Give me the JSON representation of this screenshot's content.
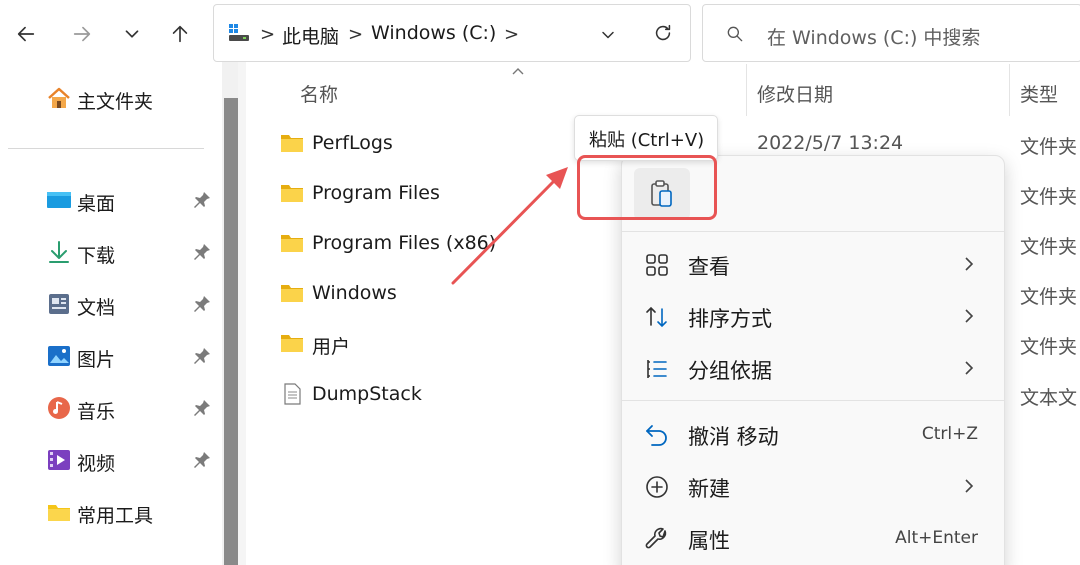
{
  "nav": {
    "back_icon": "arrow-left-icon",
    "forward_icon": "arrow-right-icon",
    "recent_icon": "chevron-down-icon",
    "up_icon": "arrow-up-icon"
  },
  "address": {
    "crumbs": [
      "此电脑",
      "Windows (C:)"
    ],
    "separator": ">"
  },
  "search": {
    "placeholder": "在 Windows (C:) 中搜索"
  },
  "sidebar": {
    "home": "主文件夹",
    "items": [
      {
        "label": "桌面",
        "icon": "desktop-icon",
        "pinned": true
      },
      {
        "label": "下载",
        "icon": "download-icon",
        "pinned": true
      },
      {
        "label": "文档",
        "icon": "document-icon",
        "pinned": true
      },
      {
        "label": "图片",
        "icon": "picture-icon",
        "pinned": true
      },
      {
        "label": "音乐",
        "icon": "music-icon",
        "pinned": true
      },
      {
        "label": "视频",
        "icon": "video-icon",
        "pinned": true
      },
      {
        "label": "常用工具",
        "icon": "folder-icon",
        "pinned": false
      }
    ]
  },
  "columns": {
    "name": "名称",
    "date": "修改日期",
    "type": "类型"
  },
  "files": [
    {
      "name": "PerfLogs",
      "date": "2022/5/7 13:24",
      "type": "文件夹",
      "icon": "folder-icon"
    },
    {
      "name": "Program Files",
      "date": "",
      "type": "文件夹",
      "icon": "folder-icon"
    },
    {
      "name": "Program Files (x86)",
      "date": "",
      "type": "文件夹",
      "icon": "folder-icon"
    },
    {
      "name": "Windows",
      "date": "",
      "type": "文件夹",
      "icon": "folder-icon"
    },
    {
      "name": "用户",
      "date": "",
      "type": "文件夹",
      "icon": "folder-icon"
    },
    {
      "name": "DumpStack",
      "date": "",
      "type": "文本文",
      "icon": "text-file-icon"
    }
  ],
  "tooltip": "粘贴 (Ctrl+V)",
  "context_menu": {
    "paste_icon": "paste-icon",
    "items": [
      {
        "label": "查看",
        "icon": "grid-icon",
        "shortcut": "",
        "submenu": true
      },
      {
        "label": "排序方式",
        "icon": "sort-icon",
        "shortcut": "",
        "submenu": true
      },
      {
        "label": "分组依据",
        "icon": "group-list-icon",
        "shortcut": "",
        "submenu": true
      },
      {
        "label": "撤消 移动",
        "icon": "undo-icon",
        "shortcut": "Ctrl+Z",
        "submenu": false
      },
      {
        "label": "新建",
        "icon": "new-plus-icon",
        "shortcut": "",
        "submenu": true
      },
      {
        "label": "属性",
        "icon": "wrench-icon",
        "shortcut": "Alt+Enter",
        "submenu": false
      }
    ]
  },
  "colors": {
    "folder": "#f5c518",
    "accent": "#0067c0",
    "highlight": "#e85454"
  }
}
